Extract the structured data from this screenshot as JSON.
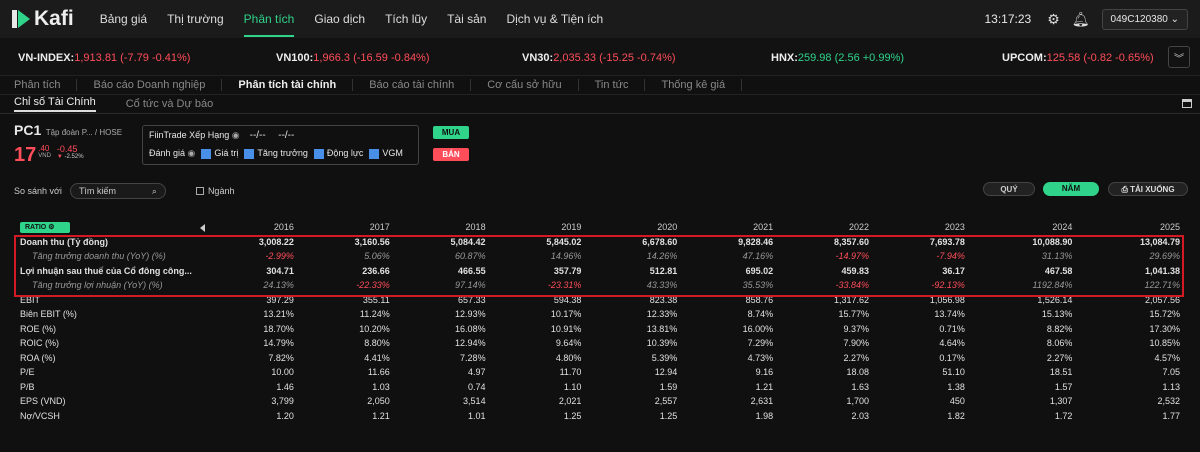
{
  "nav": {
    "logo": "Kafi",
    "items": [
      "Bảng giá",
      "Thị trường",
      "Phân tích",
      "Giao dịch",
      "Tích lũy",
      "Tài sản",
      "Dịch vụ & Tiện ích"
    ],
    "active_index": 2,
    "clock": "13:17:23",
    "account": "049C120380"
  },
  "ticker": [
    {
      "name": "VN-INDEX:",
      "value": "1,913.81",
      "change": "(-7.79",
      "pct": "-0.41%)",
      "dir": "down"
    },
    {
      "name": "VN100:",
      "value": "1,966.3",
      "change": "(-16.59",
      "pct": "-0.84%)",
      "dir": "down"
    },
    {
      "name": "VN30:",
      "value": "2,035.33",
      "change": "(-15.25",
      "pct": "-0.74%)",
      "dir": "down"
    },
    {
      "name": "HNX:",
      "value": "259.98",
      "change": "(2.56",
      "pct": "+0.99%)",
      "dir": "up"
    },
    {
      "name": "UPCOM:",
      "value": "125.58",
      "change": "(-0.82",
      "pct": "-0.65%)",
      "dir": "down"
    }
  ],
  "subtabs": [
    "Phân tích",
    "Báo cáo Doanh nghiệp",
    "Phân tích tài chính",
    "Báo cáo tài chính",
    "Cơ cấu sở hữu",
    "Tin tức",
    "Thống kê giá"
  ],
  "subtabs_active": 2,
  "subtabs2": [
    "Chỉ số Tài Chính",
    "Cổ tức và Dự báo"
  ],
  "stock": {
    "symbol": "PC1",
    "company": "Tập đoàn P... / HOSE",
    "price_int": "17",
    "price_dec": ".40",
    "unit": "VND",
    "change": "-0.45",
    "change_pct": "-2.52%"
  },
  "filntrade": {
    "label": "FiinTrade Xếp Hạng",
    "val1": "--/--",
    "val2": "--/--",
    "rate_label": "Đánh giá",
    "checks": [
      "Giá trị",
      "Tăng trưởng",
      "Động lực",
      "VGM"
    ]
  },
  "buttons": {
    "buy": "MUA",
    "sell": "BÁN",
    "quarter": "QUÝ",
    "year": "NĂM",
    "download": "TẢI XUỐNG"
  },
  "compare": {
    "label": "So sánh với",
    "search_placeholder": "Tìm kiếm",
    "industry": "Ngành"
  },
  "table": {
    "ratio_label": "RATIO",
    "years": [
      "2016",
      "2017",
      "2018",
      "2019",
      "2020",
      "2021",
      "2022",
      "2023",
      "2024",
      "2025"
    ],
    "rows": [
      {
        "label": "Doanh thu (Tỷ đồng)",
        "style": "bold",
        "values": [
          "3,008.22",
          "3,160.56",
          "5,084.42",
          "5,845.02",
          "6,678.60",
          "9,828.46",
          "8,357.60",
          "7,693.78",
          "10,088.90",
          "13,084.79"
        ]
      },
      {
        "label": "Tăng trưởng doanh thu (YoY) (%)",
        "style": "ital",
        "values": [
          "-2.99%",
          "5.06%",
          "60.87%",
          "14.96%",
          "14.26%",
          "47.16%",
          "-14.97%",
          "-7.94%",
          "31.13%",
          "29.69%"
        ]
      },
      {
        "label": "Lợi nhuận sau thuế của Cổ đông công...",
        "style": "bold",
        "values": [
          "304.71",
          "236.66",
          "466.55",
          "357.79",
          "512.81",
          "695.02",
          "459.83",
          "36.17",
          "467.58",
          "1,041.38"
        ]
      },
      {
        "label": "Tăng trưởng lợi nhuận (YoY) (%)",
        "style": "ital",
        "values": [
          "24.13%",
          "-22.33%",
          "97.14%",
          "-23.31%",
          "43.33%",
          "35.53%",
          "-33.84%",
          "-92.13%",
          "1192.84%",
          "122.71%"
        ]
      },
      {
        "label": "EBIT",
        "style": "normal",
        "values": [
          "397.29",
          "355.11",
          "657.33",
          "594.38",
          "823.38",
          "858.76",
          "1,317.62",
          "1,056.98",
          "1,526.14",
          "2,057.56"
        ]
      },
      {
        "label": "Biên EBIT (%)",
        "style": "normal",
        "values": [
          "13.21%",
          "11.24%",
          "12.93%",
          "10.17%",
          "12.33%",
          "8.74%",
          "15.77%",
          "13.74%",
          "15.13%",
          "15.72%"
        ]
      },
      {
        "label": "ROE (%)",
        "style": "normal",
        "values": [
          "18.70%",
          "10.20%",
          "16.08%",
          "10.91%",
          "13.81%",
          "16.00%",
          "9.37%",
          "0.71%",
          "8.82%",
          "17.30%"
        ]
      },
      {
        "label": "ROIC (%)",
        "style": "normal",
        "values": [
          "14.79%",
          "8.80%",
          "12.94%",
          "9.64%",
          "10.39%",
          "7.29%",
          "7.90%",
          "4.64%",
          "8.06%",
          "10.85%"
        ]
      },
      {
        "label": "ROA (%)",
        "style": "normal",
        "values": [
          "7.82%",
          "4.41%",
          "7.28%",
          "4.80%",
          "5.39%",
          "4.73%",
          "2.27%",
          "0.17%",
          "2.27%",
          "4.57%"
        ]
      },
      {
        "label": "P/E",
        "style": "normal",
        "values": [
          "10.00",
          "11.66",
          "4.97",
          "11.70",
          "12.94",
          "9.16",
          "18.08",
          "51.10",
          "18.51",
          "7.05"
        ]
      },
      {
        "label": "P/B",
        "style": "normal",
        "values": [
          "1.46",
          "1.03",
          "0.74",
          "1.10",
          "1.59",
          "1.21",
          "1.63",
          "1.38",
          "1.57",
          "1.13"
        ]
      },
      {
        "label": "EPS (VND)",
        "style": "normal",
        "values": [
          "3,799",
          "2,050",
          "3,514",
          "2,021",
          "2,557",
          "2,631",
          "1,700",
          "450",
          "1,307",
          "2,532"
        ]
      },
      {
        "label": "Nợ/VCSH",
        "style": "normal",
        "values": [
          "1.20",
          "1.21",
          "1.01",
          "1.25",
          "1.25",
          "1.98",
          "2.03",
          "1.82",
          "1.72",
          "1.77"
        ]
      }
    ]
  }
}
